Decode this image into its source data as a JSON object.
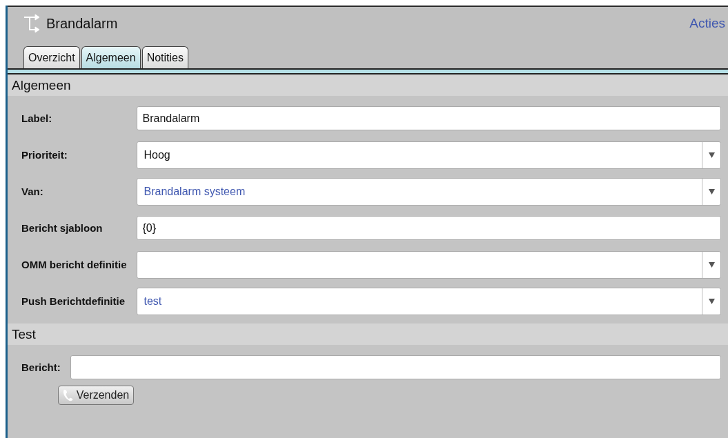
{
  "header": {
    "title": "Brandalarm",
    "action": "Acties"
  },
  "tabs": [
    {
      "label": "Overzicht",
      "selected": false
    },
    {
      "label": "Algemeen",
      "selected": true
    },
    {
      "label": "Notities",
      "selected": false
    }
  ],
  "sections": [
    {
      "title": "Algemeen",
      "fields": [
        {
          "label": "Label:",
          "kind": "text",
          "value": "Brandalarm"
        },
        {
          "label": "Prioriteit:",
          "kind": "select",
          "value": "Hoog",
          "linked": false
        },
        {
          "label": "Van:",
          "kind": "select",
          "value": "Brandalarm systeem",
          "linked": true
        },
        {
          "label": "Bericht sjabloon",
          "kind": "text",
          "value": "{0}"
        },
        {
          "label": "OMM bericht definitie",
          "kind": "select"
        },
        {
          "label": "Push Berichtdefinitie",
          "kind": "select",
          "value": "test",
          "linked": true
        }
      ]
    },
    {
      "title": "Test",
      "fields": [
        {
          "label": "Bericht:",
          "kind": "text"
        }
      ],
      "button": "Verzenden"
    }
  ]
}
